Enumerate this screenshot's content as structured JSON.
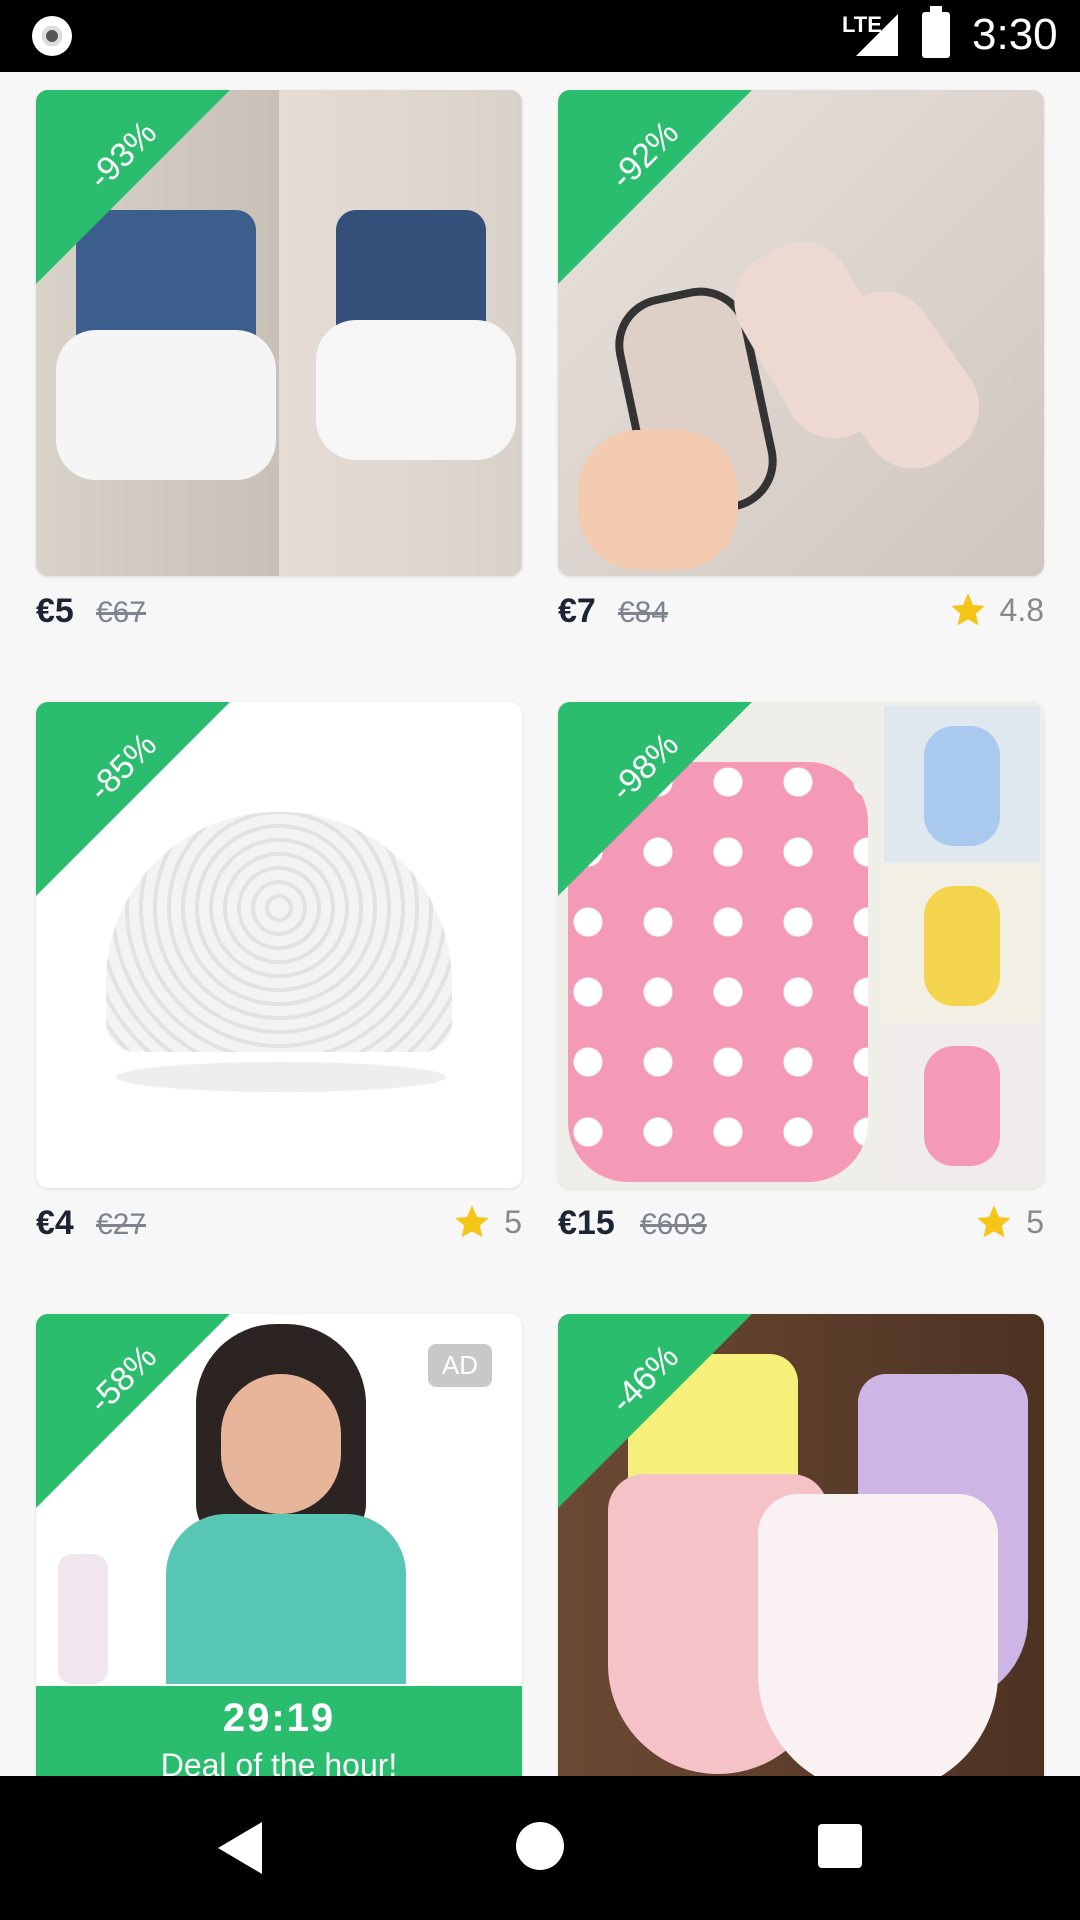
{
  "status_bar": {
    "network": "LTE",
    "time": "3:30"
  },
  "products": [
    {
      "discount": "-93%",
      "price": "€5",
      "old_price": "€67",
      "rating": ""
    },
    {
      "discount": "-92%",
      "price": "€7",
      "old_price": "€84",
      "rating": "4.8"
    },
    {
      "discount": "-85%",
      "price": "€4",
      "old_price": "€27",
      "rating": "5"
    },
    {
      "discount": "-98%",
      "price": "€15",
      "old_price": "€603",
      "rating": "5"
    },
    {
      "discount": "-58%",
      "ad": "AD",
      "timer": "29:19",
      "deal_label": "Deal of the hour!"
    },
    {
      "discount": "-46%"
    }
  ],
  "icons": {
    "star": "star-icon",
    "back": "back-icon",
    "home": "home-icon",
    "recent": "recent-apps-icon"
  },
  "colors": {
    "accent": "#2bbd6e",
    "star": "#f5c518",
    "text": "#1d2433",
    "muted": "#7d8490"
  }
}
